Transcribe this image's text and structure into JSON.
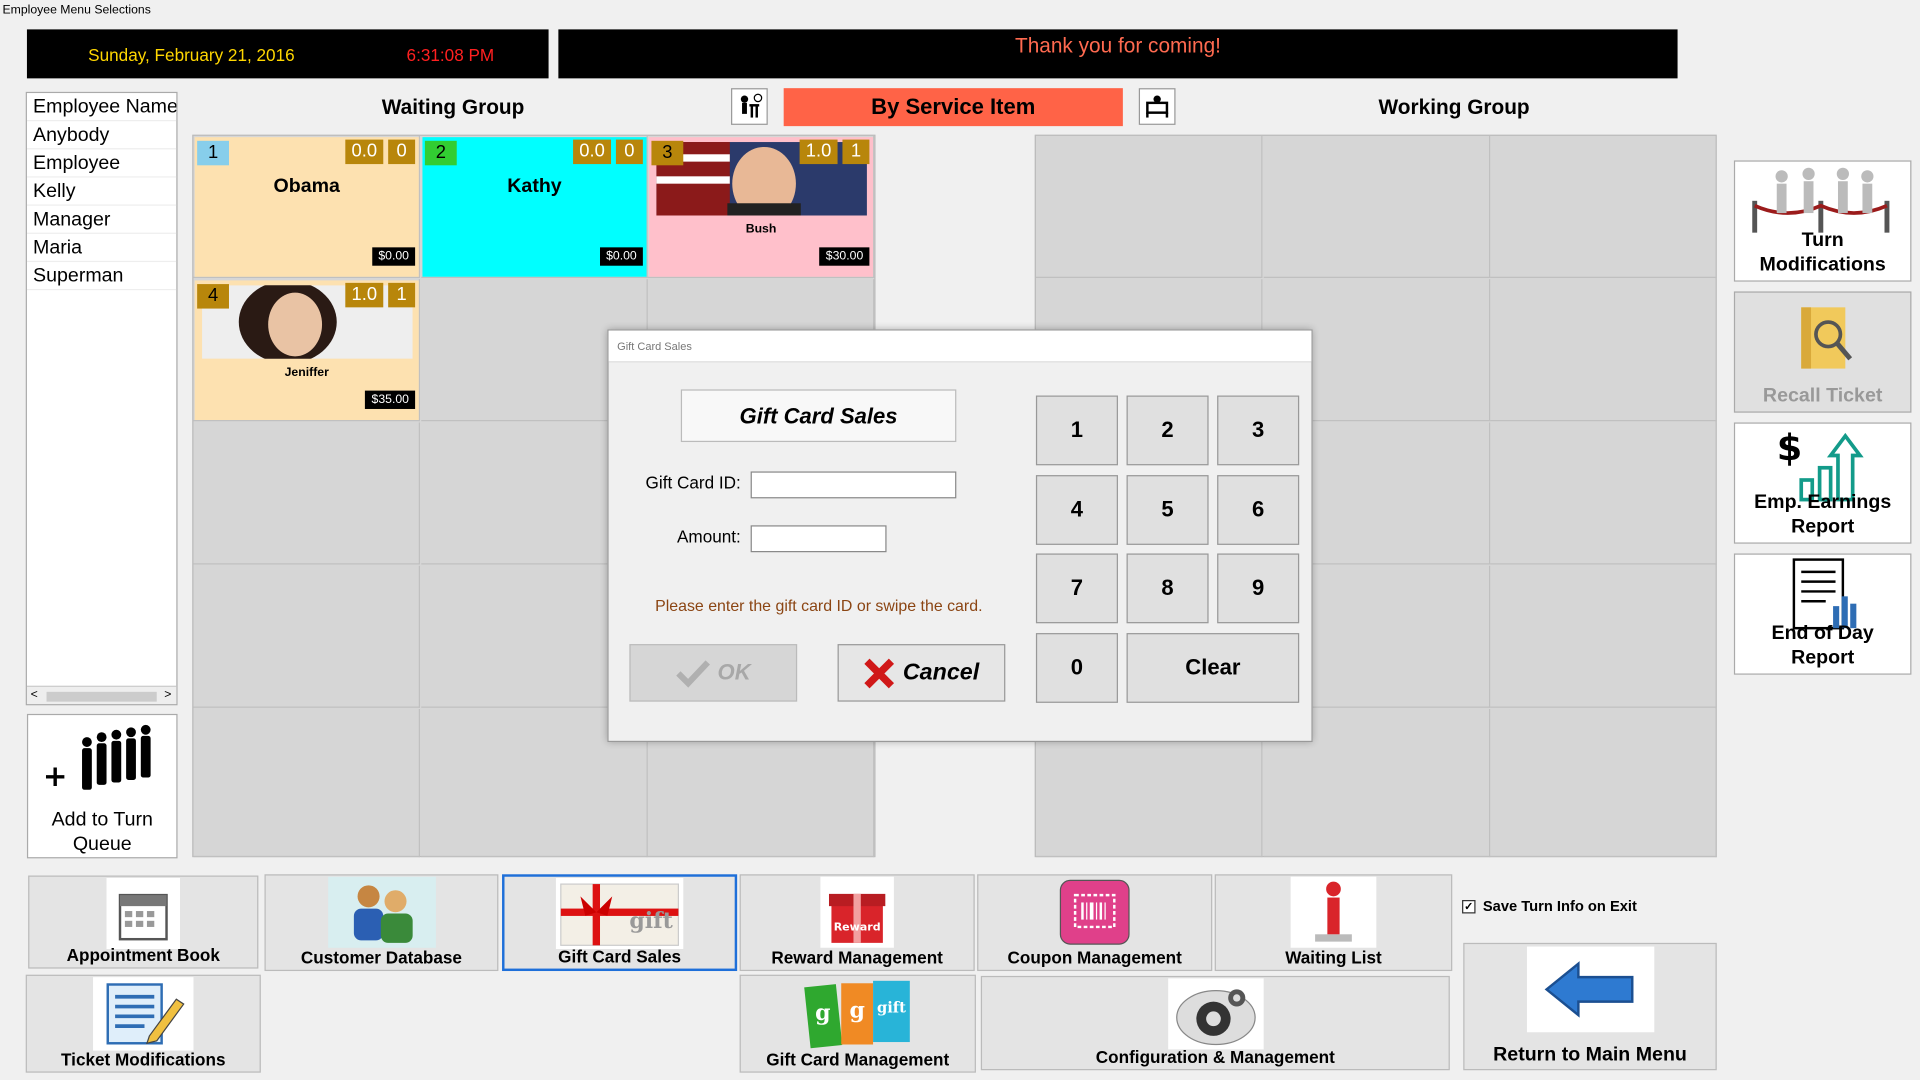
{
  "window": {
    "title": "Employee Menu Selections"
  },
  "header": {
    "date": "Sunday, February 21, 2016",
    "time": "6:31:08 PM",
    "marquee": "Thank you for coming!"
  },
  "groups": {
    "waiting": "Waiting Group",
    "working": "Working Group",
    "mode": "By Service Item"
  },
  "employee_list": {
    "header": "Employee Name",
    "items": [
      "Anybody",
      "Employee",
      "Kelly",
      "Manager",
      "Maria",
      "Superman"
    ]
  },
  "add_queue": {
    "label_line1": "Add to Turn",
    "label_line2": "Queue"
  },
  "waiting": [
    {
      "num": "1",
      "turn_a": "0.0",
      "turn_b": "0",
      "name": "Obama",
      "amount": "$0.00",
      "color": "#fde1b0"
    },
    {
      "num": "2",
      "turn_a": "0.0",
      "turn_b": "0",
      "name": "Kathy",
      "amount": "$0.00",
      "color": "#00ffff"
    },
    {
      "num": "3",
      "turn_a": "1.0",
      "turn_b": "1",
      "name": "Bush",
      "amount": "$30.00",
      "color": "#ffc0cb"
    },
    {
      "num": "4",
      "turn_a": "1.0",
      "turn_b": "1",
      "name": "Jeniffer",
      "amount": "$35.00",
      "color": "#fde1b0"
    }
  ],
  "right_buttons": [
    {
      "line1": "Turn",
      "line2": "Modifications"
    },
    {
      "line1": "Recall Ticket",
      "line2": ""
    },
    {
      "line1": "Emp. Earnings",
      "line2": "Report"
    },
    {
      "line1": "End of Day",
      "line2": "Report"
    }
  ],
  "bottom": {
    "appointment": "Appointment Book",
    "customer_db": "Customer Database",
    "gift_sales": "Gift Card Sales",
    "reward": "Reward Management",
    "coupon": "Coupon Management",
    "waiting_list": "Waiting List",
    "ticket_mod": "Ticket Modifications",
    "gift_mgmt": "Gift Card Management",
    "config": "Configuration & Management",
    "return": "Return to Main Menu",
    "save_turn": "Save Turn Info on Exit",
    "save_turn_checked": true
  },
  "dialog": {
    "title": "Gift Card Sales",
    "heading": "Gift Card Sales",
    "id_label": "Gift Card ID:",
    "id_value": "",
    "amount_label": "Amount:",
    "amount_value": "",
    "message": "Please enter the gift card ID or swipe the card.",
    "ok": "OK",
    "cancel": "Cancel",
    "keys": [
      "1",
      "2",
      "3",
      "4",
      "5",
      "6",
      "7",
      "8",
      "9",
      "0"
    ],
    "clear": "Clear"
  },
  "colors": {
    "accent": "#ff6347",
    "turn_badge": "#b8860b",
    "marquee_text": "#ff6a50",
    "date_text": "#ffd700",
    "time_text": "#ff2020"
  }
}
